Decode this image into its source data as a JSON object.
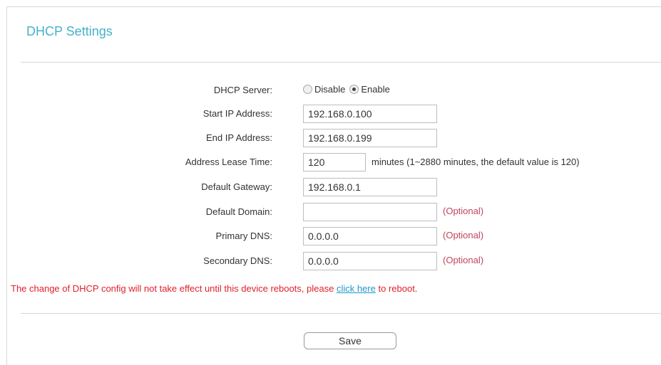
{
  "page": {
    "title": "DHCP Settings"
  },
  "form": {
    "dhcp_server": {
      "label": "DHCP Server:",
      "options": [
        "Disable",
        "Enable"
      ],
      "selected": "Enable"
    },
    "start_ip": {
      "label": "Start IP Address:",
      "value": "192.168.0.100"
    },
    "end_ip": {
      "label": "End IP Address:",
      "value": "192.168.0.199"
    },
    "lease_time": {
      "label": "Address Lease Time:",
      "value": "120",
      "hint": "minutes (1~2880 minutes, the default value is 120)"
    },
    "gateway": {
      "label": "Default Gateway:",
      "value": "192.168.0.1"
    },
    "domain": {
      "label": "Default Domain:",
      "value": "",
      "optional": "(Optional)"
    },
    "primary_dns": {
      "label": "Primary DNS:",
      "value": "0.0.0.0",
      "optional": "(Optional)"
    },
    "secondary_dns": {
      "label": "Secondary DNS:",
      "value": "0.0.0.0",
      "optional": "(Optional)"
    }
  },
  "notice": {
    "before": "The change of DHCP config will not take effect until this device reboots, please ",
    "link": "click here",
    "after": " to reboot."
  },
  "actions": {
    "save_label": "Save"
  },
  "colors": {
    "title": "#45b1c9",
    "notice": "#e0202a",
    "link": "#1e97c9",
    "optional": "#c0445b"
  }
}
